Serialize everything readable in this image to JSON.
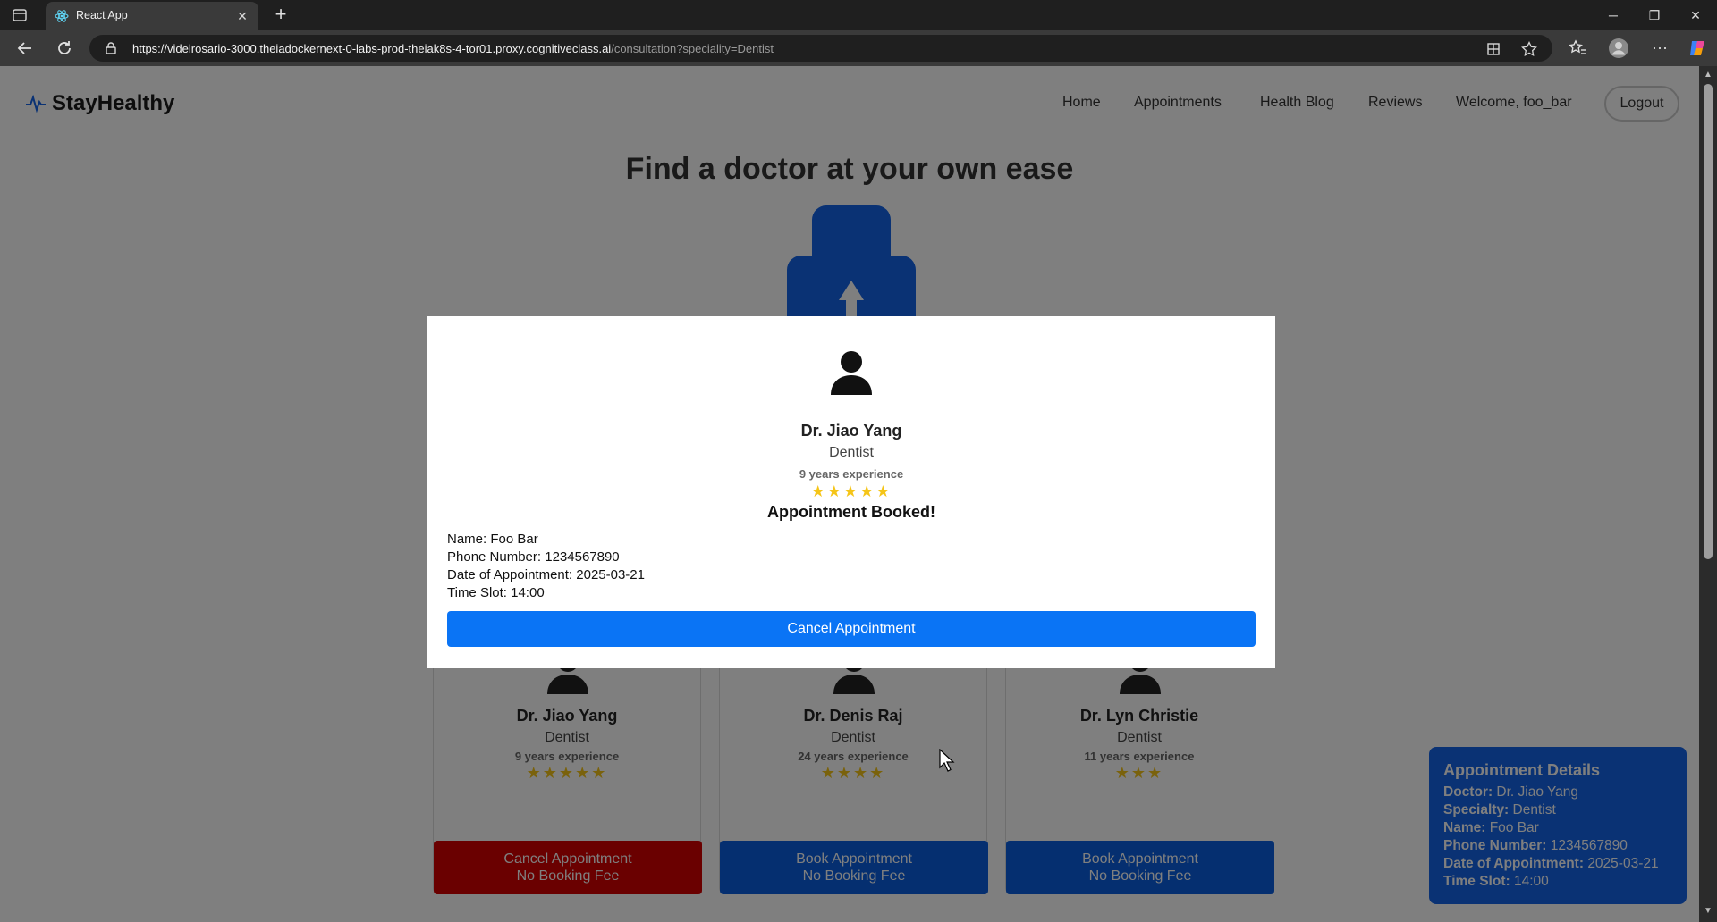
{
  "browser": {
    "tab_title": "React App",
    "url_host": "https://videlrosario-3000.theiadockernext-0-labs-prod-theiak8s-4-tor01.proxy.cognitiveclass.ai",
    "url_path": "/consultation?speciality=Dentist"
  },
  "navbar": {
    "logo_text": "StayHealthy",
    "links": [
      "Home",
      "Appointments",
      "Health Blog",
      "Reviews"
    ],
    "welcome": "Welcome, foo_bar",
    "logout": "Logout"
  },
  "hero": {
    "title": "Find a doctor at your own ease"
  },
  "modal": {
    "doctor_name": "Dr. Jiao Yang",
    "speciality": "Dentist",
    "experience": "9 years experience",
    "stars": "★★★★★",
    "booked_label": "Appointment Booked!",
    "name_line": "Name: Foo Bar",
    "phone_line": "Phone Number: 1234567890",
    "date_line": "Date of Appointment: 2025-03-21",
    "time_line": "Time Slot: 14:00",
    "cancel_button": "Cancel Appointment"
  },
  "doctors": [
    {
      "name": "Dr. Jiao Yang",
      "speciality": "Dentist",
      "experience": "9 years experience",
      "stars": "★★★★★",
      "rating": 5,
      "button_line1": "Cancel Appointment",
      "button_line2": "No Booking Fee",
      "button_color": "#d40000"
    },
    {
      "name": "Dr. Denis Raj",
      "speciality": "Dentist",
      "experience": "24 years experience",
      "stars": "★★★★",
      "rating": 4,
      "button_line1": "Book Appointment",
      "button_line2": "No Booking Fee",
      "button_color": "#0a5fe0"
    },
    {
      "name": "Dr. Lyn Christie",
      "speciality": "Dentist",
      "experience": "11 years experience",
      "stars": "★★★",
      "rating": 3,
      "button_line1": "Book Appointment",
      "button_line2": "No Booking Fee",
      "button_color": "#0a5fe0"
    }
  ],
  "appointment_details": {
    "title": "Appointment Details",
    "doctor_label": "Doctor:",
    "doctor_value": "Dr. Jiao Yang",
    "specialty_label": "Specialty:",
    "specialty_value": "Dentist",
    "name_label": "Name:",
    "name_value": "Foo Bar",
    "phone_label": "Phone Number:",
    "phone_value": "1234567890",
    "date_label": "Date of Appointment:",
    "date_value": "2025-03-21",
    "time_label": "Time Slot:",
    "time_value": "14:00"
  },
  "colors": {
    "primary_blue": "#0a74f5",
    "cancel_red": "#d40000",
    "details_bg": "#1565e8",
    "star": "#f5c518"
  }
}
